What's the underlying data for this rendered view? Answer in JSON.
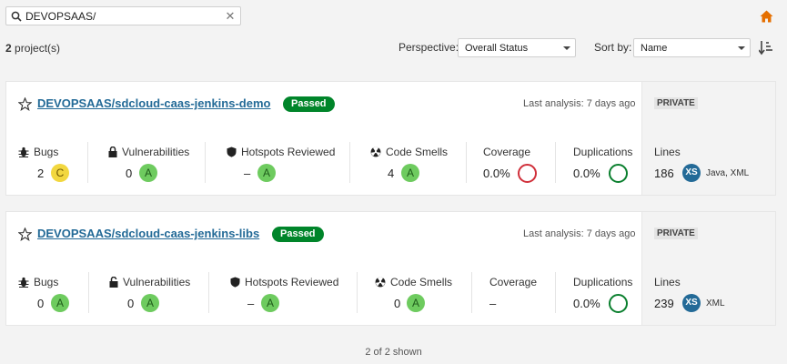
{
  "search": {
    "value": "DEVOPSAAS/"
  },
  "summary": {
    "count": "2",
    "suffix": " project(s)"
  },
  "perspective": {
    "label": "Perspective:",
    "value": "Overall Status"
  },
  "sort": {
    "label": "Sort by:",
    "value": "Name"
  },
  "projects": [
    {
      "name": "DEVOPSAAS/sdcloud-caas-jenkins-demo",
      "status": "Passed",
      "last_analysis": "Last analysis: 7 days ago",
      "visibility": "PRIVATE",
      "bugs": {
        "label": "Bugs",
        "value": "2",
        "rating": "C"
      },
      "vulnerabilities": {
        "label": "Vulnerabilities",
        "value": "0",
        "rating": "A"
      },
      "hotspots": {
        "label": "Hotspots Reviewed",
        "value": "–",
        "rating": "A"
      },
      "smells": {
        "label": "Code Smells",
        "value": "4",
        "rating": "A"
      },
      "coverage": {
        "label": "Coverage",
        "value": "0.0%"
      },
      "duplications": {
        "label": "Duplications",
        "value": "0.0%"
      },
      "lines": {
        "label": "Lines",
        "value": "186",
        "size": "XS",
        "languages": "Java, XML"
      }
    },
    {
      "name": "DEVOPSAAS/sdcloud-caas-jenkins-libs",
      "status": "Passed",
      "last_analysis": "Last analysis: 7 days ago",
      "visibility": "PRIVATE",
      "bugs": {
        "label": "Bugs",
        "value": "0",
        "rating": "A"
      },
      "vulnerabilities": {
        "label": "Vulnerabilities",
        "value": "0",
        "rating": "A"
      },
      "hotspots": {
        "label": "Hotspots Reviewed",
        "value": "–",
        "rating": "A"
      },
      "smells": {
        "label": "Code Smells",
        "value": "0",
        "rating": "A"
      },
      "coverage": {
        "label": "Coverage",
        "value": "–"
      },
      "duplications": {
        "label": "Duplications",
        "value": "0.0%"
      },
      "lines": {
        "label": "Lines",
        "value": "239",
        "size": "XS",
        "languages": "XML"
      }
    }
  ],
  "footer": {
    "shown": "2 of 2 shown"
  },
  "colors": {
    "link": "#236a97",
    "passed": "#00852a",
    "rating_a": "#6ecb5f",
    "rating_c": "#f2d73f",
    "home": "#e56f00"
  }
}
